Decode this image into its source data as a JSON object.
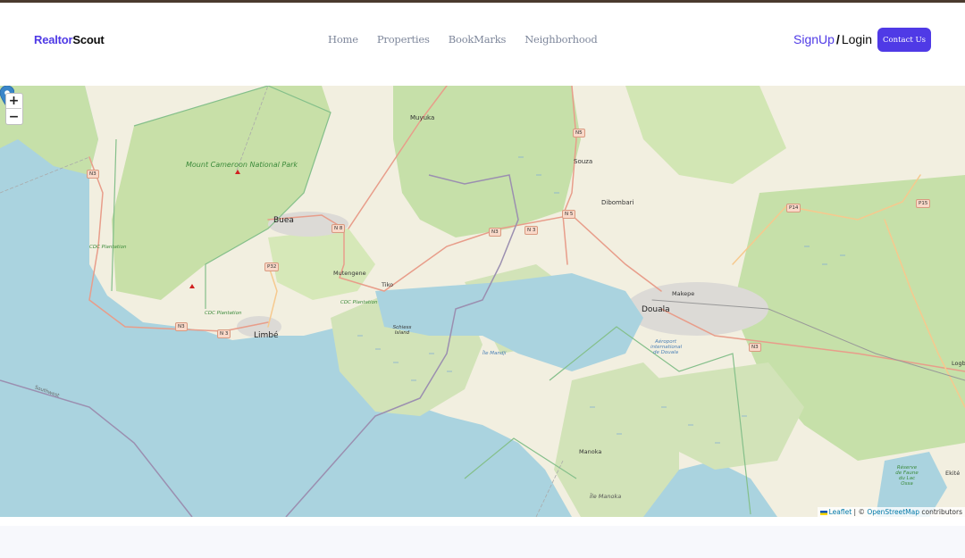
{
  "header": {
    "logo_part1": "Realtor",
    "logo_part2": "Scout",
    "nav": [
      "Home",
      "Properties",
      "BookMarks",
      "Neighborhood"
    ],
    "signup_label": "SignUp",
    "separator": "/",
    "login_label": "Login",
    "contact_label": "Contact Us"
  },
  "colors": {
    "brand": "#4f3ae6",
    "nav_text": "#7e879b",
    "footer_bg": "#f7f8fc"
  },
  "map": {
    "zoom_in_label": "+",
    "zoom_out_label": "−",
    "marker_icon": "map-pin-icon",
    "labels": {
      "mount_cameroon": "Mount Cameroon National Park",
      "buea": "Buea",
      "muyuka": "Muyuka",
      "souza": "Souza",
      "dibombari": "Dibombari",
      "mutengene": "Mutengene",
      "tiko": "Tiko",
      "limbe": "Limbé",
      "douala": "Douala",
      "makepe": "Makepe",
      "airport": "Aéroport international de Douala",
      "schiess": "Schiess Island",
      "ile_mandji": "Île Mandji",
      "manoka": "Manoka",
      "ile_manoka": "Île Manoka",
      "cdc1": "CDC Plantation",
      "cdc2": "CDC Plantation",
      "cdc3": "CDC Plantation",
      "southwest": "Southwest",
      "logb": "Logb",
      "ekite": "Ekité",
      "reserve": "Réserve de Faune du Lac Ossa"
    },
    "shields": {
      "n3_a": "N3",
      "n3_b": "N 3",
      "n3_c": "N3",
      "n3_d": "N 3",
      "n3_e": "N3",
      "n3_f": "N3",
      "n8": "N 8",
      "p32": "P32",
      "n5_a": "N5",
      "n5_b": "N 5",
      "p14": "P14",
      "p15": "P15"
    },
    "attribution": {
      "leaflet": "Leaflet",
      "sep": " | © ",
      "osm": "OpenStreetMap",
      "suffix": " contributors"
    }
  }
}
